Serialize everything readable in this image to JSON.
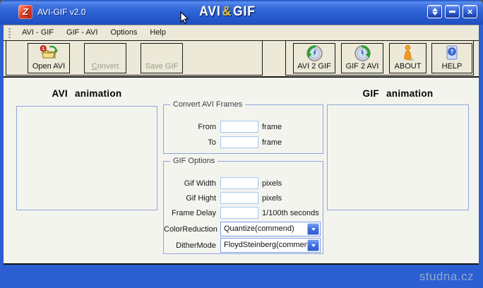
{
  "window": {
    "title": "AVI-GIF v2.0",
    "brand": {
      "avi": "AVI",
      "amp": "&",
      "gif": "GIF"
    }
  },
  "menu": {
    "items": [
      "AVI - GIF",
      "GIF - AVI",
      "Options",
      "Help"
    ]
  },
  "toolbar": {
    "open_avi": "Open AVI",
    "convert": "Convert",
    "save_gif": "Save GIF",
    "avi2gif": "AVI 2 GIF",
    "gif2avi": "GIF 2 AVI",
    "about": "ABOUT",
    "help": "HELP"
  },
  "main": {
    "avi_heading": "AVI animation",
    "gif_heading": "GIF animation"
  },
  "convert_frames": {
    "title": "Convert AVI Frames",
    "from_label": "From",
    "from_value": "",
    "from_suffix": "frame",
    "to_label": "To",
    "to_value": "",
    "to_suffix": "frame"
  },
  "gif_options": {
    "title": "GIF Options",
    "width_label": "Gif Width",
    "width_value": "",
    "width_suffix": "pixels",
    "hight_label": "Gif Hight",
    "hight_value": "",
    "hight_suffix": "pixels",
    "delay_label": "Frame Delay",
    "delay_value": "",
    "delay_suffix": "1/100th seconds",
    "colorreduction_label": "ColorReduction",
    "colorreduction_value": "Quantize(commend)",
    "dithermode_label": "DitherMode",
    "dithermode_value": "FloydSteinberg(commend"
  },
  "watermark": "studna.cz",
  "colors": {
    "frame_blue": "#2b5fd2",
    "menubar_bg": "#ece9d8",
    "client_bg": "#f4f4ef",
    "brand_gold": "#e3c235",
    "group_border": "#8fa3dc",
    "input_border": "#a6c8f2",
    "disabled_text": "#9e9c8e",
    "watermark_text": "#93a8cf"
  }
}
